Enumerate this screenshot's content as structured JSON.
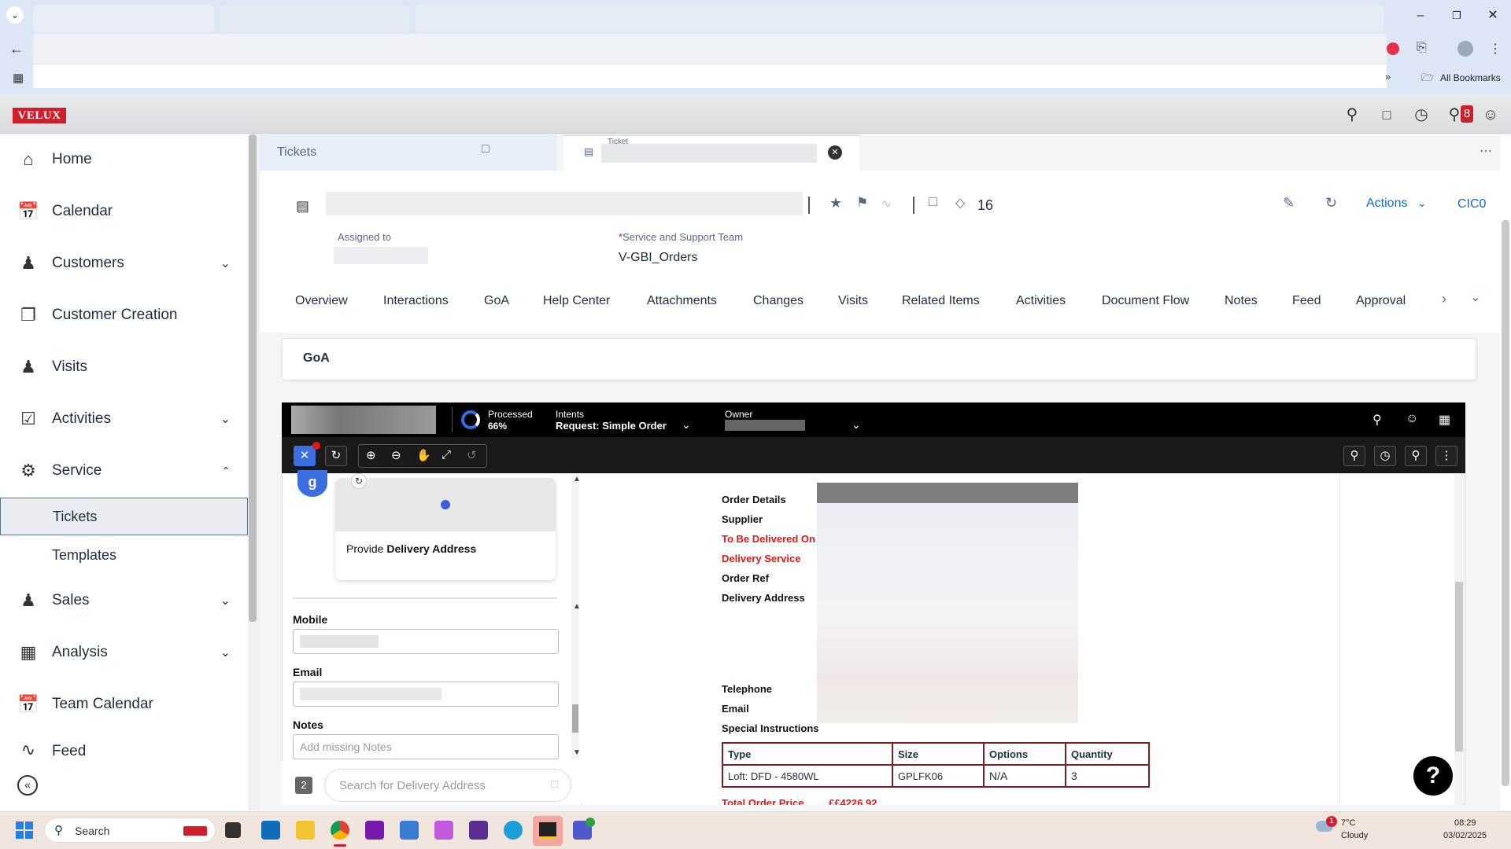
{
  "browser": {
    "bookmarks_label": "All Bookmarks"
  },
  "app": {
    "logo": "VELUX",
    "notification_count": "8"
  },
  "sidebar": {
    "items": [
      {
        "label": "Home",
        "icon": "home-icon"
      },
      {
        "label": "Calendar",
        "icon": "calendar-icon"
      },
      {
        "label": "Customers",
        "icon": "customers-icon"
      },
      {
        "label": "Customer Creation",
        "icon": "customer-creation-icon"
      },
      {
        "label": "Visits",
        "icon": "visits-icon"
      },
      {
        "label": "Activities",
        "icon": "activities-icon"
      },
      {
        "label": "Service",
        "icon": "service-icon"
      },
      {
        "label": "Sales",
        "icon": "sales-icon"
      },
      {
        "label": "Analysis",
        "icon": "analysis-icon"
      },
      {
        "label": "Team Calendar",
        "icon": "team-calendar-icon"
      },
      {
        "label": "Feed",
        "icon": "feed-icon"
      }
    ],
    "sub_items": [
      {
        "label": "Tickets"
      },
      {
        "label": "Templates"
      }
    ]
  },
  "tabs": {
    "tickets": "Tickets",
    "ticket": "Ticket"
  },
  "header": {
    "count": "16",
    "actions": "Actions",
    "status_code": "CIC0",
    "assigned_to_label": "Assigned to",
    "team_label": "Service and Support Team",
    "team_required": "*",
    "team_value": "V-GBI_Orders"
  },
  "nav_tabs": [
    "Overview",
    "Interactions",
    "GoA",
    "Help Center",
    "Attachments",
    "Changes",
    "Visits",
    "Related Items",
    "Activities",
    "Document Flow",
    "Notes",
    "Feed",
    "Approval"
  ],
  "goa_title": "GoA",
  "embedded": {
    "processed_label": "Processed",
    "processed_value": "66%",
    "processed_pct": 66,
    "intents_label": "Intents",
    "intents_value": "Request: Simple Order",
    "owner_label": "Owner",
    "delivery_card_prefix": "Provide ",
    "delivery_card_bold": "Delivery Address",
    "mobile_label": "Mobile",
    "email_label": "Email",
    "notes_label": "Notes",
    "notes_placeholder": "Add missing Notes",
    "step_number": "2",
    "search_placeholder": "Search for Delivery Address"
  },
  "order": {
    "labels": {
      "order_details": "Order Details",
      "supplier": "Supplier",
      "to_be_delivered_on": "To Be Delivered On",
      "delivery_service": "Delivery Service",
      "order_ref": "Order Ref",
      "delivery_address": "Delivery Address",
      "telephone": "Telephone",
      "email": "Email",
      "special_instructions": "Special Instructions",
      "total_order_price": "Total Order Price"
    },
    "total_value": "££4226.92",
    "table_headers": [
      "Type",
      "Size",
      "Options",
      "Quantity"
    ],
    "table_rows": [
      [
        "Loft: DFD - 4580WL",
        "GPLFK06",
        "N/A",
        "3"
      ]
    ]
  },
  "taskbar": {
    "search": "Search",
    "weather_temp": "7°C",
    "weather_desc": "Cloudy",
    "weather_badge": "1",
    "time": "08:29",
    "date": "03/02/2025"
  },
  "colors": {
    "brand": "#d21d2a",
    "required_red": "#e01818"
  }
}
